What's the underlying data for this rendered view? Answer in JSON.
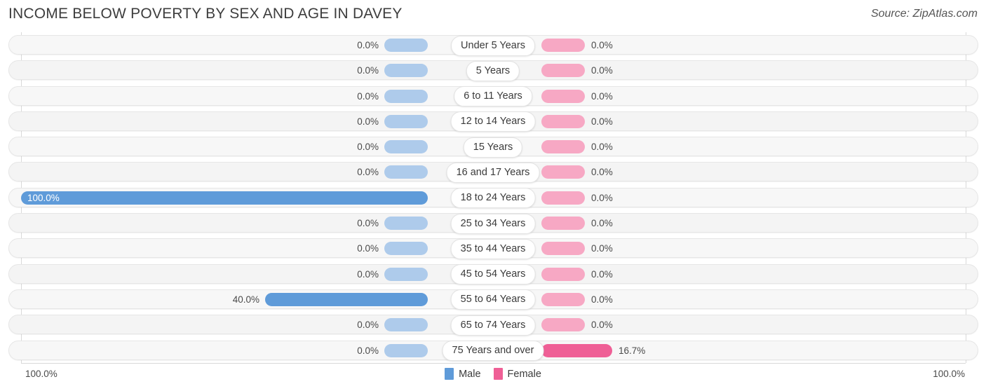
{
  "header": {
    "title": "INCOME BELOW POVERTY BY SEX AND AGE IN DAVEY",
    "source": "Source: ZipAtlas.com"
  },
  "legend": {
    "male_label": "Male",
    "female_label": "Female",
    "male_color": "#5f9bd9",
    "female_color": "#ef5f96"
  },
  "axis": {
    "left_tick": "100.0%",
    "right_tick": "100.0%",
    "max": 100.0
  },
  "colors": {
    "male_light": "#aecbeb",
    "male_strong": "#5f9bd9",
    "female_light": "#f7a8c4",
    "female_strong": "#ef5f96",
    "track": "#f6f6f6",
    "text": "#3b3b3b"
  },
  "chart_data": {
    "type": "bar",
    "orientation": "horizontal-diverging",
    "title": "INCOME BELOW POVERTY BY SEX AND AGE IN DAVEY",
    "xlabel": "",
    "ylabel": "",
    "xlim": [
      0,
      100
    ],
    "grid": false,
    "legend_position": "bottom-center",
    "categories": [
      "Under 5 Years",
      "5 Years",
      "6 to 11 Years",
      "12 to 14 Years",
      "15 Years",
      "16 and 17 Years",
      "18 to 24 Years",
      "25 to 34 Years",
      "35 to 44 Years",
      "45 to 54 Years",
      "55 to 64 Years",
      "65 to 74 Years",
      "75 Years and over"
    ],
    "series": [
      {
        "name": "Male",
        "values": [
          0.0,
          0.0,
          0.0,
          0.0,
          0.0,
          0.0,
          100.0,
          0.0,
          0.0,
          0.0,
          40.0,
          0.0,
          0.0
        ],
        "labels": [
          "0.0%",
          "0.0%",
          "0.0%",
          "0.0%",
          "0.0%",
          "0.0%",
          "100.0%",
          "0.0%",
          "0.0%",
          "0.0%",
          "40.0%",
          "0.0%",
          "0.0%"
        ]
      },
      {
        "name": "Female",
        "values": [
          0.0,
          0.0,
          0.0,
          0.0,
          0.0,
          0.0,
          0.0,
          0.0,
          0.0,
          0.0,
          0.0,
          0.0,
          16.7
        ],
        "labels": [
          "0.0%",
          "0.0%",
          "0.0%",
          "0.0%",
          "0.0%",
          "0.0%",
          "0.0%",
          "0.0%",
          "0.0%",
          "0.0%",
          "0.0%",
          "0.0%",
          "16.7%"
        ]
      }
    ]
  }
}
